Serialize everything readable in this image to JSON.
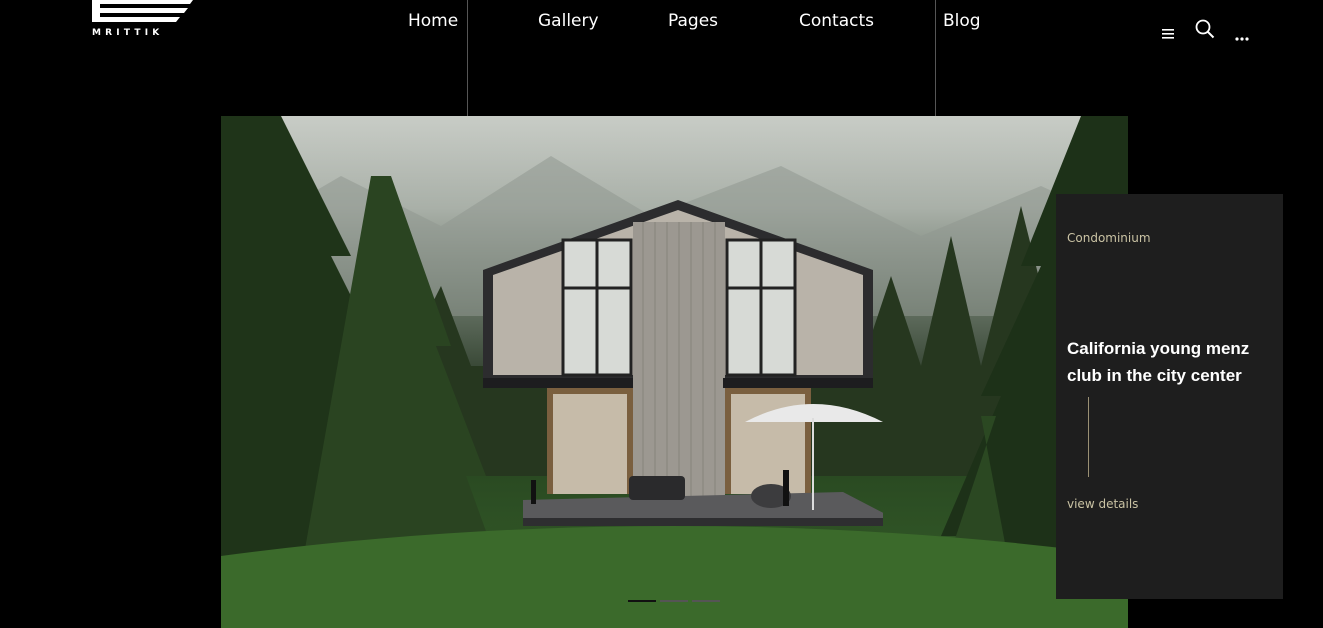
{
  "brand": {
    "name": "MRITTIK"
  },
  "nav": {
    "items": [
      {
        "label": "Home"
      },
      {
        "label": "Gallery"
      },
      {
        "label": "Pages"
      },
      {
        "label": "Contacts"
      },
      {
        "label": "Blog"
      }
    ]
  },
  "header_icons": [
    "menu-icon",
    "search-icon",
    "more-icon"
  ],
  "hero": {
    "image": "modern wooden A-frame house in pine forest",
    "slide_count": 3,
    "active_slide": 1
  },
  "card": {
    "category": "Condominium",
    "title": "California young menz club in the city center",
    "link": "view details"
  },
  "colors": {
    "accent": "#c9c2a3",
    "card_bg": "#1e1e1e",
    "page_bg": "#000000"
  }
}
